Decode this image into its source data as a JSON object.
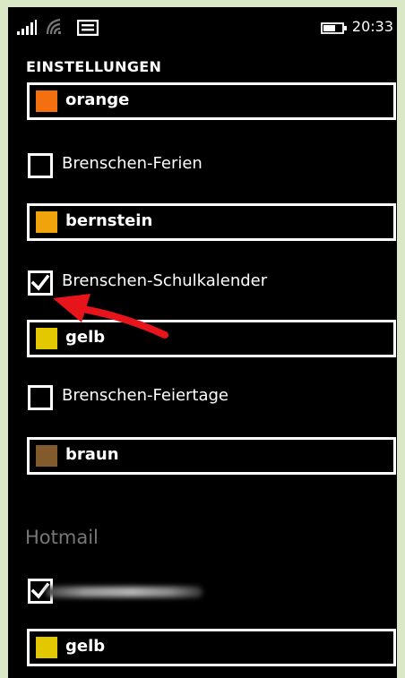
{
  "status_bar": {
    "time": "20:33",
    "icons": [
      "signal-strength-icon",
      "wifi-icon",
      "message-icon",
      "battery-icon"
    ]
  },
  "page_title": "EINSTELLUNGEN",
  "calendars": [
    {
      "label": "Brenschen-Ferien",
      "checked": false,
      "color_name": "orange",
      "color": "#f36f10"
    },
    {
      "label": "Brenschen-Schulkalender",
      "checked": true,
      "color_name": "bernstein",
      "color": "#f0a30a"
    },
    {
      "label": "Brenschen-Feiertage",
      "checked": false,
      "color_name": "gelb",
      "color": "#e3c800"
    }
  ],
  "dropdown_top": {
    "color_name": "orange",
    "color": "#f36f10"
  },
  "dropdowns": [
    {
      "color_name": "orange",
      "color": "#f36f10"
    },
    {
      "color_name": "bernstein",
      "color": "#f0a30a"
    },
    {
      "color_name": "gelb",
      "color": "#e3c800"
    },
    {
      "color_name": "braun",
      "color": "#825a2c"
    },
    {
      "color_name": "gelb",
      "color": "#e3c800"
    }
  ],
  "checkboxes": [
    {
      "label": "Brenschen-Ferien",
      "checked": false
    },
    {
      "label": "Brenschen-Schulkalender",
      "checked": true
    },
    {
      "label": "Brenschen-Feiertage",
      "checked": false
    },
    {
      "label": "",
      "checked": true
    }
  ],
  "hotmail_section": {
    "header": "Hotmail"
  },
  "annotation": {
    "arrow_color": "#e8141b",
    "icon": "red-arrow-icon"
  }
}
